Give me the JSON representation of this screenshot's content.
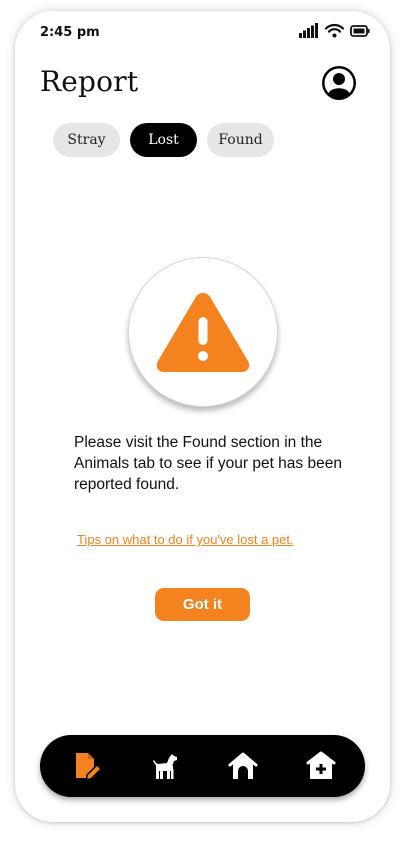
{
  "status_bar": {
    "time": "2:45 pm"
  },
  "header": {
    "title": "Report"
  },
  "tabs": [
    {
      "label": "Stray",
      "active": false
    },
    {
      "label": "Lost",
      "active": true
    },
    {
      "label": "Found",
      "active": false
    }
  ],
  "content": {
    "message": "Please visit the Found section in the Animals tab to see if your pet has been reported found.",
    "tips_link": "Tips on what to do if you've lost a pet.",
    "got_it_label": "Got it"
  },
  "bottom_nav": {
    "items": [
      {
        "icon": "report-icon",
        "active": true
      },
      {
        "icon": "dog-icon",
        "active": false
      },
      {
        "icon": "home-icon",
        "active": false
      },
      {
        "icon": "shelter-icon",
        "active": false
      }
    ]
  },
  "colors": {
    "accent": "#f4821e",
    "active_tab": "#000000",
    "tab_bg": "#e6e6e6"
  }
}
